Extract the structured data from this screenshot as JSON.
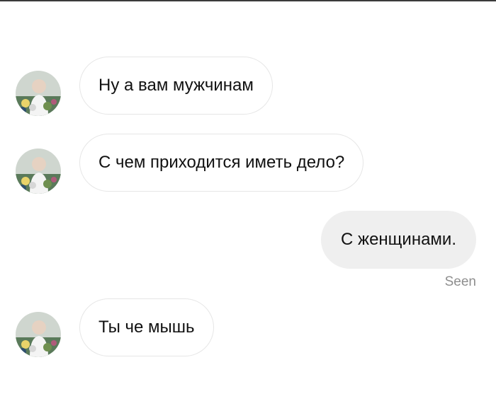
{
  "conversation": {
    "messages": [
      {
        "sender": "them",
        "text": "Ну а вам мужчинам"
      },
      {
        "sender": "them",
        "text": "С чем приходится иметь дело?"
      },
      {
        "sender": "me",
        "text": "С женщинами."
      },
      {
        "sender": "them",
        "text": "Ты че мышь"
      }
    ],
    "read_receipt": "Seen"
  },
  "colors": {
    "incoming_border": "#e6e6e6",
    "outgoing_bg": "#efefef",
    "seen_text": "#8e8e8e"
  },
  "icons": {
    "contact_avatar": "profile-photo-avatar"
  }
}
